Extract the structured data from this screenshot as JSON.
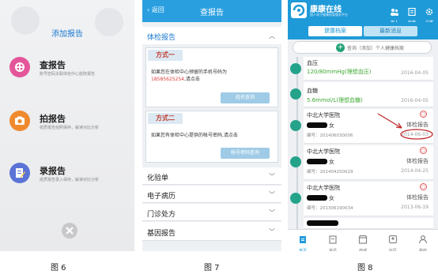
{
  "panel1": {
    "title": "添加报告",
    "items": [
      {
        "label": "查报告",
        "sub": "账号密码关联体检中心能既报告",
        "icon": "search-report-icon",
        "color": "#e3569a"
      },
      {
        "label": "拍报告",
        "sub": "纸质报告拍照保存，解读对比分析",
        "icon": "camera-icon",
        "color": "#ef8a2e"
      },
      {
        "label": "录报告",
        "sub": "纸质报告录入保存，解读对比分析",
        "icon": "edit-document-icon",
        "color": "#5b73d6"
      }
    ],
    "close_icon": "close-icon",
    "caption": "图 6"
  },
  "panel2": {
    "back_label": "返回",
    "title": "查报告",
    "section_title": "体检报告",
    "method1": {
      "tag": "方式一",
      "text1": "如果您在体检中心预留的手机号码为",
      "phone": "18585625254",
      "text2": ",请点击",
      "button": "姓名查询"
    },
    "method2": {
      "tag": "方式二",
      "text": "如果您有体检中心提供的帐号密码,请点击",
      "button": "帐号密码查询"
    },
    "sections": [
      "化验单",
      "电子病历",
      "门诊处方",
      "基因报告"
    ],
    "caption": "图 7"
  },
  "panel3": {
    "app_name": "康康在线",
    "slogan": "国人电子健康档案服务平台",
    "header_icons": [
      {
        "label": "家人",
        "icon": "family-icon"
      },
      {
        "label": "检查",
        "icon": "report-icon"
      },
      {
        "label": "设置",
        "icon": "gear-icon"
      }
    ],
    "tabs": [
      "健康档案",
      "最新消息"
    ],
    "search_placeholder": "查询（添加）个人健康档案",
    "records": [
      {
        "name": "血压",
        "value": "120/80mmHg(理想血压)",
        "date": "2016-04-05"
      },
      {
        "name": "血糖",
        "value": "5.6mmol/L(理想血糖)",
        "date": "2016-04-05"
      }
    ],
    "reports": [
      {
        "hospital": "中北大学医院",
        "gender": "女",
        "number": "编号：201406030006",
        "type": "体检报告",
        "date": "2014-06-03"
      },
      {
        "hospital": "中北大学医院",
        "gender": "女",
        "number": "编号：201404250029",
        "type": "体检报告",
        "date": "2014-04-25"
      },
      {
        "hospital": "中北大学医院",
        "gender": "女",
        "number": "编号：201306190034",
        "type": "体检报告",
        "date": "2013-06-19"
      }
    ],
    "nav": [
      {
        "label": "首页",
        "icon": "home-icon"
      },
      {
        "label": "资讯",
        "icon": "news-icon"
      },
      {
        "label": "商城",
        "icon": "store-icon"
      },
      {
        "label": "社区",
        "icon": "community-icon"
      },
      {
        "label": "我的",
        "icon": "user-icon"
      }
    ],
    "caption": "图 8"
  },
  "colors": {
    "primary": "#1f9ad8",
    "accent_red": "#e03c3c",
    "green": "#3ea832"
  }
}
